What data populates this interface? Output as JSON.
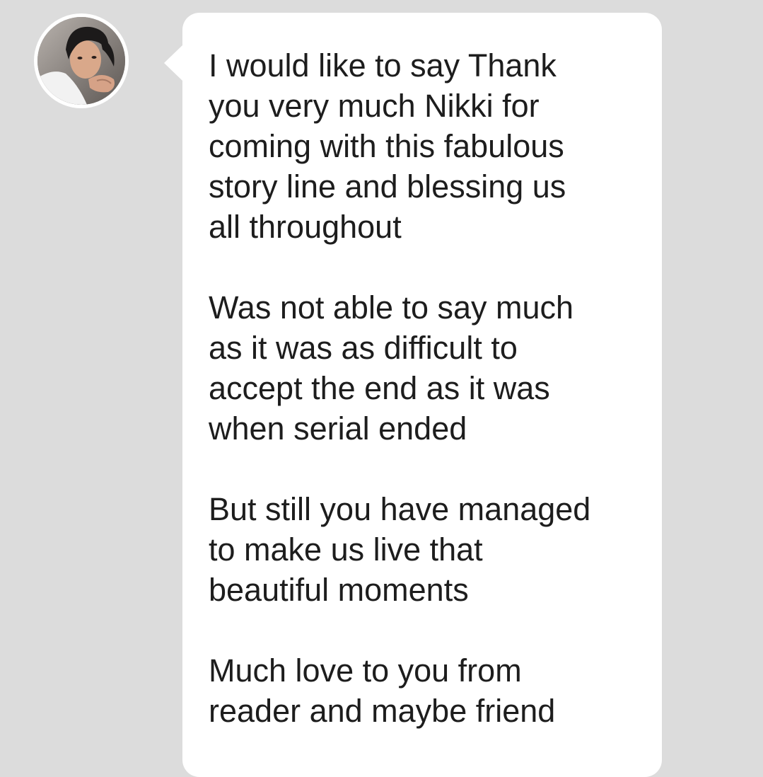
{
  "conversation": {
    "sender_avatar": "avatar-photo",
    "message": {
      "paragraphs": [
        "I would like to say Thank\nyou very much Nikki for\ncoming with this fabulous\nstory line and blessing us\nall throughout",
        "Was not able to say much\nas it was as difficult to\naccept the end as it was\nwhen serial ended",
        "But still you have managed\nto make us live that\nbeautiful moments",
        "Much love to you from\nreader and maybe friend"
      ]
    }
  },
  "colors": {
    "background": "#dcdcdc",
    "bubble": "#ffffff",
    "text": "#1d1d1d"
  }
}
